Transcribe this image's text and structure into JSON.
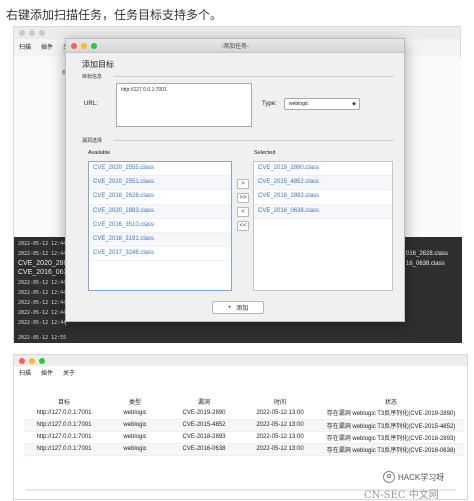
{
  "caption": "右键添加扫描任务，任务目标支持多个。",
  "app": {
    "menu": [
      "扫描",
      "插件",
      "关于"
    ],
    "bg_label": "目标",
    "log": {
      "timestamps": [
        "2022-05-12 12:44",
        "2022-05-12 12:44",
        "2022-05-12 12:44",
        "2022-05-12 12:44",
        "2022-05-12 12:44",
        "2022-05-12 12:44",
        "2022-05-12 12:44",
        "2022-05-12 12:44"
      ],
      "bracket": "[",
      "lines_big": [
        "CVE_2020_2883.",
        "CVE_2016_0638."
      ],
      "right_lines": [
        "016_2628.class",
        "16_0638.class"
      ],
      "last_ts": "2022-05-12 12:55"
    }
  },
  "dialog": {
    "window_title": "-添加任务-",
    "heading": "添加目标",
    "section_target": "目标信息",
    "url_label": "URL:",
    "url_value": "http://127.0.0.1:7001",
    "type_label": "Type:",
    "type_value": "weblogic",
    "section_vuln": "漏洞选择",
    "available_label": "Available",
    "selected_label": "Selected",
    "available": [
      "CVE_2020_2555.class",
      "CVE_2020_2551.class",
      "CVE_2018_2628.class",
      "CVE_2020_2883.class",
      "CVE_2016_3510.class",
      "CVE_2018_3191.class",
      "CVE_2017_3248.class"
    ],
    "selected": [
      "CVE_2019_2890.class",
      "CVE_2015_4852.class",
      "CVE_2018_2893.class",
      "CVE_2016_0638.class"
    ],
    "arrows": [
      ">",
      ">>",
      "<",
      "<<"
    ],
    "add_icon": "+",
    "add_label": "添加"
  },
  "table_window": {
    "menu": [
      "扫描",
      "插件",
      "关于"
    ],
    "columns": [
      "目标",
      "类型",
      "漏洞",
      "时间",
      "状态"
    ],
    "rows": [
      [
        "http://127.0.0.1:7001",
        "weblogic",
        "CVE-2019-2890",
        "2022-05-12 13:00",
        "存在漏洞 weblogic T3反序列化(CVE-2019-2890)"
      ],
      [
        "http://127.0.0.1:7001",
        "weblogic",
        "CVE-2015-4852",
        "2022-05-12 13:00",
        "存在漏洞 weblogic T3反序列化(CVE-2015-4852)"
      ],
      [
        "http://127.0.0.1:7001",
        "weblogic",
        "CVE-2018-2893",
        "2022-05-12 13:00",
        "存在漏洞 weblogic T3反序列化(CVE-2018-2893)"
      ],
      [
        "http://127.0.0.1:7001",
        "weblogic",
        "CVE-2016-0638",
        "2022-05-12 13:00",
        "存在漏洞 weblogic T3反序列化(CVE-2016-0638)"
      ]
    ]
  },
  "watermark": {
    "text": "HACK学习呀",
    "site": "CN-SEC 中文网"
  },
  "colors": {
    "link": "#3a73c6",
    "log_bg": "#2f2f2f",
    "list_border": "#7ea7d8"
  }
}
